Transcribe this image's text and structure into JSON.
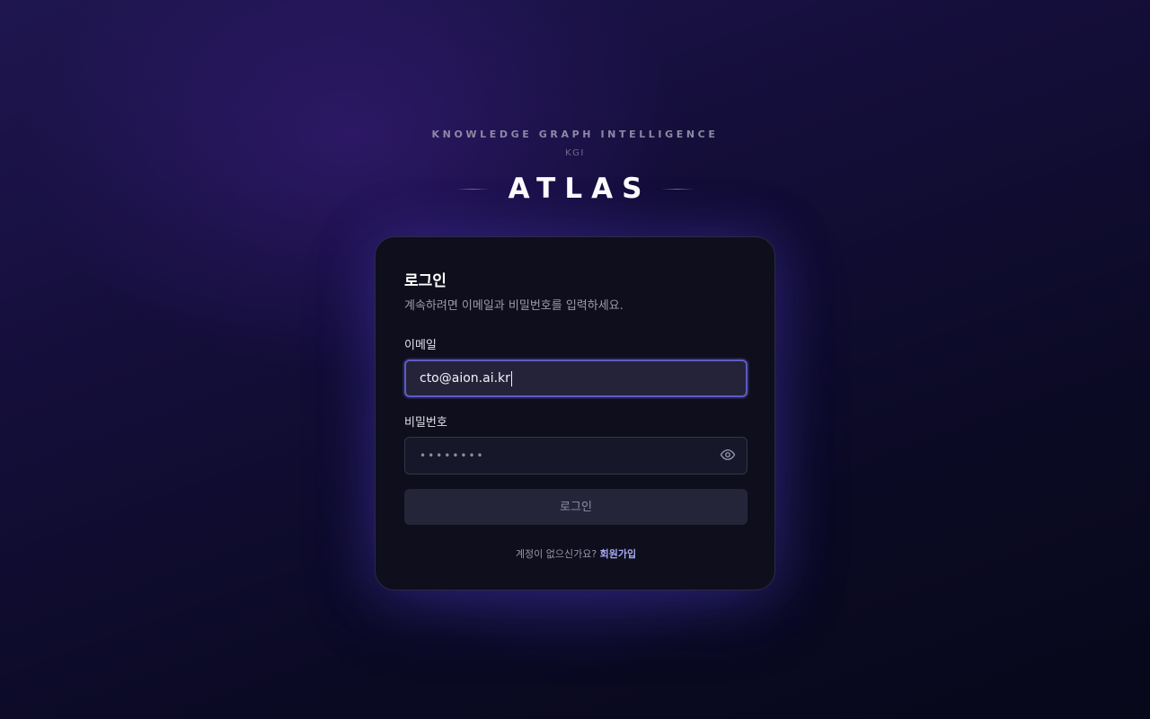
{
  "brand": {
    "tagline": "KNOWLEDGE GRAPH INTELLIGENCE",
    "short": "KGI",
    "title": "ATLAS"
  },
  "login": {
    "title": "로그인",
    "subtitle": "계속하려면 이메일과 비밀번호를 입력하세요.",
    "email_label": "이메일",
    "email_value": "cto@aion.ai.kr",
    "password_label": "비밀번호",
    "password_masked": "••••••••",
    "submit_label": "로그인",
    "signup_prompt": "계정이 없으신가요?",
    "signup_link": "회원가입"
  },
  "colors": {
    "accent": "#5e5cc4",
    "link": "#a7a8f2",
    "card_bg": "#0e0e1c"
  },
  "icons": {
    "password_toggle": "eye-icon"
  }
}
